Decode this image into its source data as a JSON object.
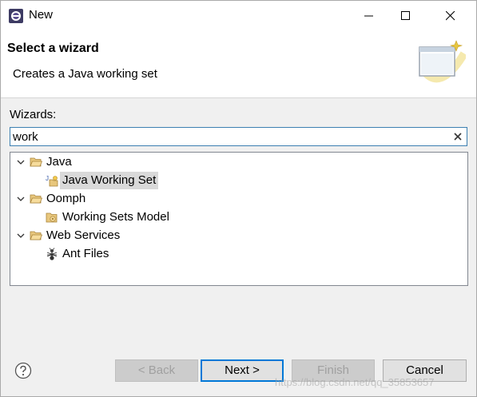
{
  "window": {
    "title": "New"
  },
  "banner": {
    "title": "Select a wizard",
    "description": "Creates a Java working set"
  },
  "filter": {
    "label": "Wizards:",
    "value": "work"
  },
  "tree": [
    {
      "label": "Java",
      "level": 0,
      "type": "folder",
      "expanded": true
    },
    {
      "label": "Java Working Set",
      "level": 1,
      "type": "java-working-set",
      "selected": true
    },
    {
      "label": "Oomph",
      "level": 0,
      "type": "folder",
      "expanded": true
    },
    {
      "label": "Working Sets Model",
      "level": 1,
      "type": "working-sets-model"
    },
    {
      "label": "Web Services",
      "level": 0,
      "type": "folder",
      "expanded": true
    },
    {
      "label": "Ant Files",
      "level": 1,
      "type": "ant"
    }
  ],
  "buttons": {
    "back": "< Back",
    "next": "Next >",
    "finish": "Finish",
    "cancel": "Cancel"
  },
  "watermark": "https://blog.csdn.net/qq_35853657",
  "colors": {
    "focus_border": "#0078d7",
    "selection": "#d9d9d9",
    "filter_border": "#3c7fb1"
  }
}
